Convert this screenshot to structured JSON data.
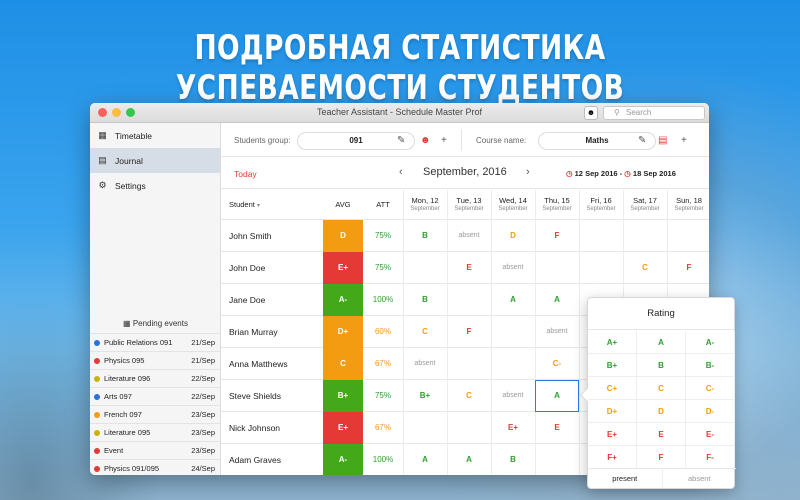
{
  "headline": "ПОДРОБНАЯ СТАТИСТИКА УСПЕВАЕМОСТИ СТУДЕНТОВ",
  "window": {
    "title": "Teacher Assistant - Schedule Master Prof",
    "search_placeholder": "Search"
  },
  "sidebar": {
    "items": [
      {
        "label": "Timetable",
        "icon": "calendar-icon"
      },
      {
        "label": "Journal",
        "icon": "journal-icon",
        "active": true
      },
      {
        "label": "Settings",
        "icon": "gear-icon"
      }
    ],
    "pending_title": "Pending events",
    "events": [
      {
        "name": "Public Relations 091",
        "date": "21/Sep",
        "color": "#2f6fd6"
      },
      {
        "name": "Physics 095",
        "date": "21/Sep",
        "color": "#e53935"
      },
      {
        "name": "Literature 096",
        "date": "22/Sep",
        "color": "#c8b400"
      },
      {
        "name": "Arts 097",
        "date": "22/Sep",
        "color": "#2f6fd6"
      },
      {
        "name": "French 097",
        "date": "23/Sep",
        "color": "#f39c12"
      },
      {
        "name": "Literature 095",
        "date": "23/Sep",
        "color": "#c8b400"
      },
      {
        "name": "Event",
        "date": "23/Sep",
        "color": "#e53935"
      },
      {
        "name": "Physics 091/095",
        "date": "24/Sep",
        "color": "#e53935"
      }
    ]
  },
  "filters": {
    "group_label": "Students group:",
    "group_value": "091",
    "course_label": "Course name:",
    "course_value": "Maths"
  },
  "datebar": {
    "today": "Today",
    "month": "September, 2016",
    "range_from": "12 Sep 2016",
    "range_sep": "-",
    "range_to": "18 Sep 2016"
  },
  "table": {
    "student_header": "Student",
    "avg_header": "AVG",
    "att_header": "ATT",
    "days": [
      {
        "weekday": "Mon, 12",
        "month": "September"
      },
      {
        "weekday": "Tue, 13",
        "month": "September"
      },
      {
        "weekday": "Wed, 14",
        "month": "September"
      },
      {
        "weekday": "Thu, 15",
        "month": "September"
      },
      {
        "weekday": "Fri, 16",
        "month": "September"
      },
      {
        "weekday": "Sat, 17",
        "month": "September"
      },
      {
        "weekday": "Sun, 18",
        "month": "September"
      }
    ],
    "rows": [
      {
        "name": "John Smith",
        "avg": "D",
        "avg_color": "#f39c12",
        "att": "75%",
        "att_color": "#2e9e2e",
        "cells": [
          "B",
          "absent",
          "D",
          "F",
          "",
          "",
          ""
        ]
      },
      {
        "name": "John Doe",
        "avg": "E+",
        "avg_color": "#e53935",
        "att": "75%",
        "att_color": "#2e9e2e",
        "cells": [
          "",
          "E",
          "absent",
          "",
          "",
          "C",
          "F"
        ]
      },
      {
        "name": "Jane Doe",
        "avg": "A-",
        "avg_color": "#43a81a",
        "att": "100%",
        "att_color": "#2e9e2e",
        "cells": [
          "B",
          "",
          "A",
          "A",
          "",
          "",
          ""
        ]
      },
      {
        "name": "Brian Murray",
        "avg": "D+",
        "avg_color": "#f39c12",
        "att": "60%",
        "att_color": "#f39c12",
        "cells": [
          "C",
          "F",
          "",
          "absent",
          "",
          "",
          ""
        ]
      },
      {
        "name": "Anna Matthews",
        "avg": "C",
        "avg_color": "#f39c12",
        "att": "67%",
        "att_color": "#f39c12",
        "cells": [
          "absent",
          "",
          "",
          "C-",
          "",
          "",
          ""
        ]
      },
      {
        "name": "Steve Shields",
        "avg": "B+",
        "avg_color": "#43a81a",
        "att": "75%",
        "att_color": "#2e9e2e",
        "cells": [
          "B+",
          "C",
          "absent",
          "A",
          "",
          "",
          ""
        ]
      },
      {
        "name": "Nick Johnson",
        "avg": "E+",
        "avg_color": "#e53935",
        "att": "67%",
        "att_color": "#f39c12",
        "cells": [
          "",
          "",
          "E+",
          "E",
          "",
          "",
          ""
        ]
      },
      {
        "name": "Adam Graves",
        "avg": "A-",
        "avg_color": "#43a81a",
        "att": "100%",
        "att_color": "#2e9e2e",
        "cells": [
          "A",
          "A",
          "B",
          "",
          "",
          "",
          ""
        ]
      }
    ]
  },
  "rating_popover": {
    "title": "Rating",
    "grades": [
      "A+",
      "A",
      "A-",
      "B+",
      "B",
      "B-",
      "C+",
      "C",
      "C-",
      "D+",
      "D",
      "D-",
      "E+",
      "E",
      "E-",
      "F+",
      "F",
      "F-"
    ],
    "present": "present",
    "absent": "absent"
  },
  "colors": {
    "A": "#2e9e2e",
    "B": "#2e9e2e",
    "C": "#f39c12",
    "D": "#f39c12",
    "E": "#e53935",
    "F": "#e53935",
    "absent": "#999999"
  }
}
